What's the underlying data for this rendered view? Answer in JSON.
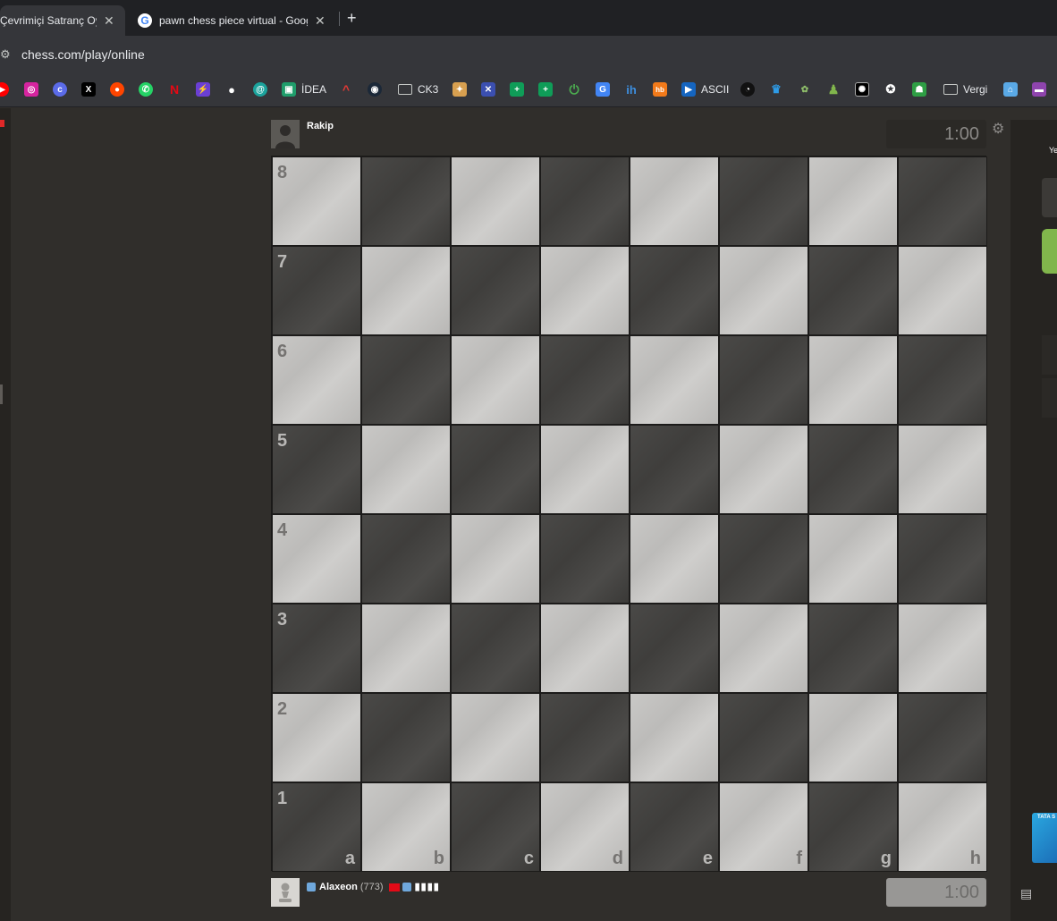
{
  "browser": {
    "tabs": [
      {
        "title": "Çevrimiçi Satranç Oyna",
        "close": "✕"
      },
      {
        "title": "pawn chess piece virtual - Goog",
        "close": "✕"
      }
    ],
    "new_tab": "+",
    "url": "chess.com/play/online",
    "bookmarks": [
      {
        "icon": "youtube-icon",
        "label": ""
      },
      {
        "icon": "instagram-icon",
        "label": ""
      },
      {
        "icon": "app-icon",
        "label": ""
      },
      {
        "icon": "x-twitter-icon",
        "label": ""
      },
      {
        "icon": "reddit-icon",
        "label": ""
      },
      {
        "icon": "whatsapp-icon",
        "label": ""
      },
      {
        "icon": "netflix-icon",
        "label": ""
      },
      {
        "icon": "bolt-icon",
        "label": ""
      },
      {
        "icon": "map-pin-icon",
        "label": ""
      },
      {
        "icon": "app-icon",
        "label": ""
      },
      {
        "icon": "idea-icon",
        "label": "İDEA"
      },
      {
        "icon": "chevron-up-icon",
        "label": ""
      },
      {
        "icon": "steam-icon",
        "label": ""
      },
      {
        "icon": "folder-icon",
        "label": "CK3"
      },
      {
        "icon": "app-icon",
        "label": ""
      },
      {
        "icon": "app-icon",
        "label": ""
      },
      {
        "icon": "sheets-icon",
        "label": ""
      },
      {
        "icon": "sheets-icon",
        "label": ""
      },
      {
        "icon": "power-icon",
        "label": ""
      },
      {
        "icon": "translate-icon",
        "label": ""
      },
      {
        "icon": "ih-icon",
        "label": ""
      },
      {
        "icon": "hb-icon",
        "label": ""
      },
      {
        "icon": "ascii-icon",
        "label": "ASCII"
      },
      {
        "icon": "speedometer-icon",
        "label": ""
      },
      {
        "icon": "crown-icon",
        "label": ""
      },
      {
        "icon": "app-icon",
        "label": ""
      },
      {
        "icon": "pawn-icon",
        "label": ""
      },
      {
        "icon": "app-icon",
        "label": ""
      },
      {
        "icon": "openai-icon",
        "label": ""
      },
      {
        "icon": "android-icon",
        "label": ""
      },
      {
        "icon": "folder-icon",
        "label": "Vergi"
      },
      {
        "icon": "app-icon",
        "label": ""
      },
      {
        "icon": "app-icon",
        "label": ""
      }
    ]
  },
  "game": {
    "opponent": {
      "name": "Rakip",
      "clock": "1:00"
    },
    "player": {
      "name": "Alaxeon",
      "rating": "(773)",
      "clock": "1:00"
    },
    "board": {
      "ranks": [
        "8",
        "7",
        "6",
        "5",
        "4",
        "3",
        "2",
        "1"
      ],
      "files": [
        "a",
        "b",
        "c",
        "d",
        "e",
        "f",
        "g",
        "h"
      ]
    }
  },
  "right_panel": {
    "partial_text": "Ye",
    "promo_text": "TATA S"
  }
}
